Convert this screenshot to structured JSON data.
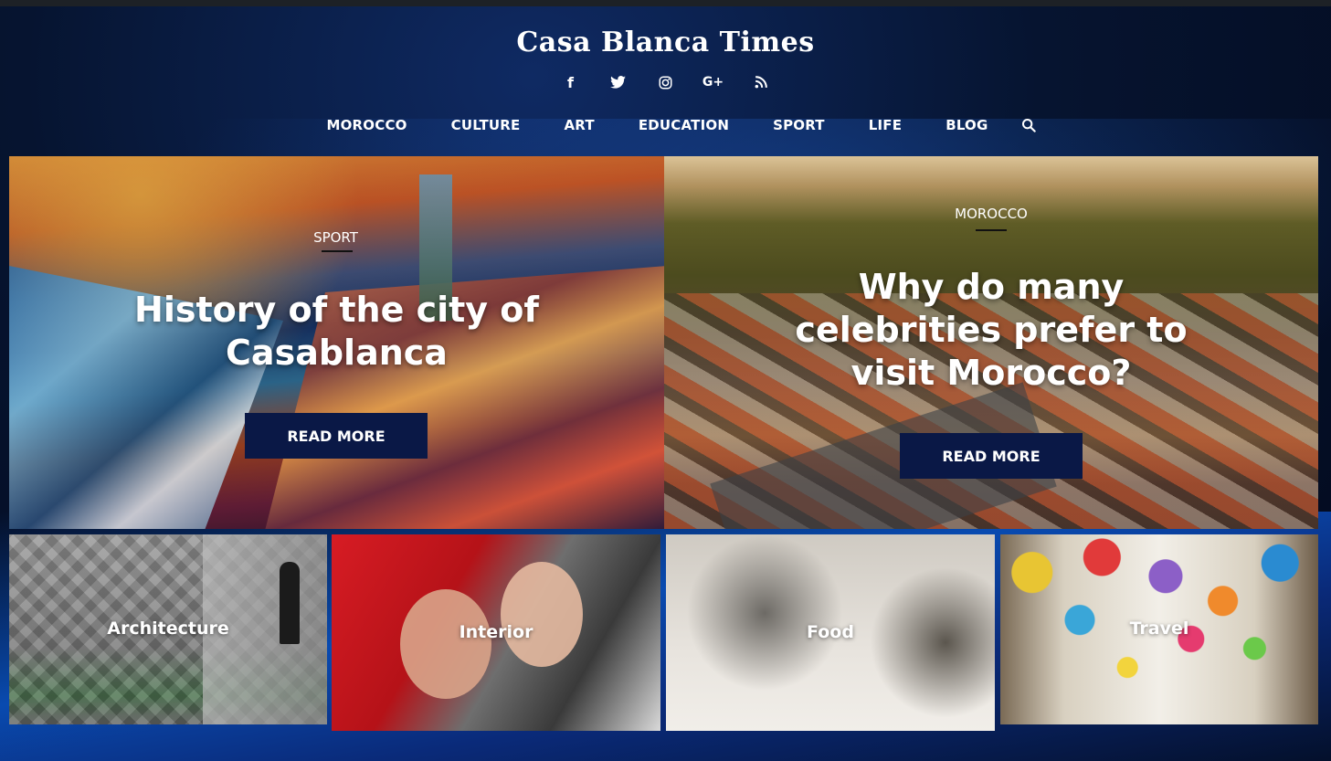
{
  "site": {
    "logo": "Casa Blanca Times"
  },
  "social": [
    {
      "name": "facebook-icon",
      "glyph": "f"
    },
    {
      "name": "twitter-icon"
    },
    {
      "name": "instagram-icon"
    },
    {
      "name": "google-plus-icon",
      "glyph": "G+"
    },
    {
      "name": "rss-icon"
    }
  ],
  "nav": {
    "items": [
      "MOROCCO",
      "CULTURE",
      "ART",
      "EDUCATION",
      "SPORT",
      "LIFE",
      "BLOG"
    ],
    "search_icon": "search-icon"
  },
  "featured": [
    {
      "category": "SPORT",
      "title": "History of the city of Casablanca",
      "button": "READ MORE"
    },
    {
      "category": "MOROCCO",
      "title": "Why do many celebrities prefer to visit Morocco?",
      "button": "READ MORE"
    }
  ],
  "tiles": [
    {
      "label": "Architecture"
    },
    {
      "label": "Interior"
    },
    {
      "label": "Food"
    },
    {
      "label": "Travel"
    }
  ],
  "colors": {
    "button_bg": "#0a1846",
    "header_bg": "#03091c",
    "text": "#ffffff"
  }
}
